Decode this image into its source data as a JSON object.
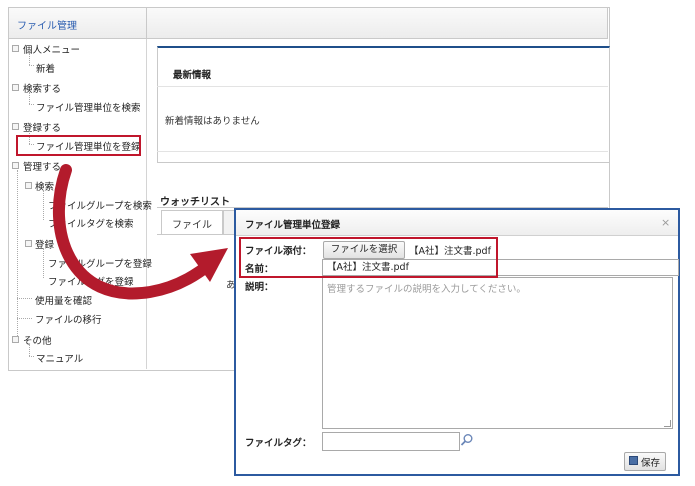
{
  "app": {
    "title": "ファイル管理"
  },
  "sidebar": {
    "items": [
      {
        "label": "個人メニュー"
      },
      {
        "label": "新着"
      },
      {
        "label": "検索する"
      },
      {
        "label": "ファイル管理単位を検索"
      },
      {
        "label": "登録する"
      },
      {
        "label": "ファイル管理単位を登録"
      },
      {
        "label": "管理する"
      },
      {
        "label": "検索"
      },
      {
        "label": "ファイルグループを検索"
      },
      {
        "label": "ファイルタグを検索"
      },
      {
        "label": "登録"
      },
      {
        "label": "ファイルグループを登録"
      },
      {
        "label": "ファイルタグを登録"
      },
      {
        "label": "使用量を確認"
      },
      {
        "label": "ファイルの移行"
      },
      {
        "label": "その他"
      },
      {
        "label": "マニュアル"
      }
    ]
  },
  "latest": {
    "title": "最新情報",
    "message": "新着情報はありません"
  },
  "watchlist": {
    "title": "ウォッチリスト",
    "tab_label": "ファイル",
    "partial_text": "ありま"
  },
  "dialog": {
    "title": "ファイル管理単位登録",
    "close_symbol": "×",
    "file_label": "ファイル添付：",
    "choose_button": "ファイルを選択",
    "file_name": "【A社】注文書.pdf",
    "name_label": "名前：",
    "name_value": "【A社】注文書.pdf",
    "desc_label": "説明：",
    "desc_placeholder": "管理するファイルの説明を入力してください。",
    "tag_label": "ファイルタグ：",
    "save_button": "保存"
  },
  "colors": {
    "highlight": "#c0162c",
    "dialog_border": "#2c5aa0",
    "title_link": "#2a5db0"
  },
  "icons": {
    "tree": "folder-icon",
    "search": "search-icon",
    "save": "save-icon",
    "close": "close-icon",
    "arrow": "curved-arrow"
  }
}
